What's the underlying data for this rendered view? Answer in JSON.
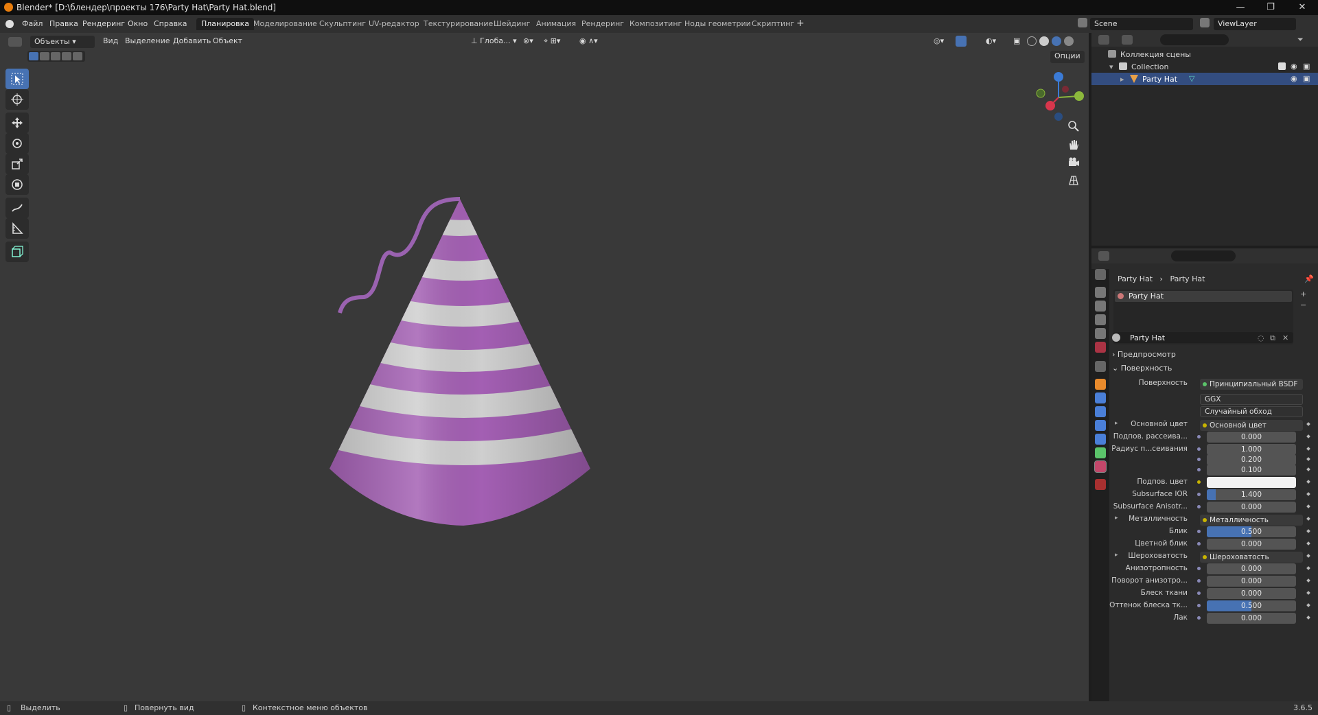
{
  "window": {
    "title": "Blender* [D:\\блендер\\проекты 176\\Party Hat\\Party Hat.blend]",
    "minimize": "—",
    "maximize": "❐",
    "close": "✕"
  },
  "menu": [
    "Файл",
    "Правка",
    "Рендеринг",
    "Окно",
    "Справка"
  ],
  "workspaces": [
    {
      "label": "Планировка",
      "active": true
    },
    {
      "label": "Моделирование"
    },
    {
      "label": "Скульптинг"
    },
    {
      "label": "UV-редактор"
    },
    {
      "label": "Текстурирование"
    },
    {
      "label": "Шейдинг"
    },
    {
      "label": "Анимация"
    },
    {
      "label": "Рендеринг"
    },
    {
      "label": "Композитинг"
    },
    {
      "label": "Ноды геометрии"
    },
    {
      "label": "Скриптинг"
    }
  ],
  "scene": {
    "name": "Scene",
    "view_layer": "ViewLayer"
  },
  "viewport_header": {
    "mode": "Объекты",
    "menus": [
      "Вид",
      "Выделение",
      "Добавить",
      "Объект"
    ],
    "transform_orientation": "Глоба...",
    "options": "Опции"
  },
  "object": {
    "name": "Party Hat",
    "stripe_colors": {
      "purple": "#a35fb3",
      "white": "#cfcfcf"
    },
    "ribbon_color": "#9a62b0"
  },
  "outliner": {
    "root": "Коллекция сцены",
    "collection": "Collection",
    "item": "Party Hat"
  },
  "properties": {
    "breadcrumb": [
      "Party Hat",
      "Party Hat"
    ],
    "material_slot": "Party Hat",
    "material_name": "Party Hat",
    "sections": {
      "preview": "Предпросмотр",
      "surface": "Поверхность"
    },
    "surface_label": "Поверхность",
    "surface_value": "Принципиальный BSDF",
    "distribution": "GGX",
    "subsurface_method": "Случайный обход",
    "rows": [
      {
        "label": "Основной цвет",
        "link": "Основной цвет",
        "type": "link"
      },
      {
        "label": "Подпов. рассеива...",
        "value": "0.000",
        "fill": 0
      },
      {
        "label": "Радиус п...сеивания",
        "value": "1.000",
        "fill": 0
      },
      {
        "label": "",
        "value": "0.200",
        "fill": 0
      },
      {
        "label": "",
        "value": "0.100",
        "fill": 0
      },
      {
        "label": "Подпов. цвет",
        "type": "color",
        "color": "#f2f2f2"
      },
      {
        "label": "Subsurface IOR",
        "value": "1.400",
        "fill": 0.1
      },
      {
        "label": "Subsurface Anisotr...",
        "value": "0.000",
        "fill": 0
      },
      {
        "label": "Металличность",
        "link": "Металличность",
        "type": "link"
      },
      {
        "label": "Блик",
        "value": "0.500",
        "fill": 0.5
      },
      {
        "label": "Цветной блик",
        "value": "0.000",
        "fill": 0
      },
      {
        "label": "Шероховатость",
        "link": "Шероховатость",
        "type": "link"
      },
      {
        "label": "Анизотропность",
        "value": "0.000",
        "fill": 0
      },
      {
        "label": "Поворот анизотро...",
        "value": "0.000",
        "fill": 0
      },
      {
        "label": "Блеск ткани",
        "value": "0.000",
        "fill": 0
      },
      {
        "label": "Оттенок блеска тк...",
        "value": "0.500",
        "fill": 0.5
      },
      {
        "label": "Лак",
        "value": "0.000",
        "fill": 0
      }
    ]
  },
  "status": {
    "select": "Выделить",
    "rotate": "Повернуть вид",
    "context": "Контекстное меню объектов",
    "version": "3.6.5"
  },
  "colors": {
    "accent": "#4772b3",
    "selected_row": "#334d80"
  }
}
